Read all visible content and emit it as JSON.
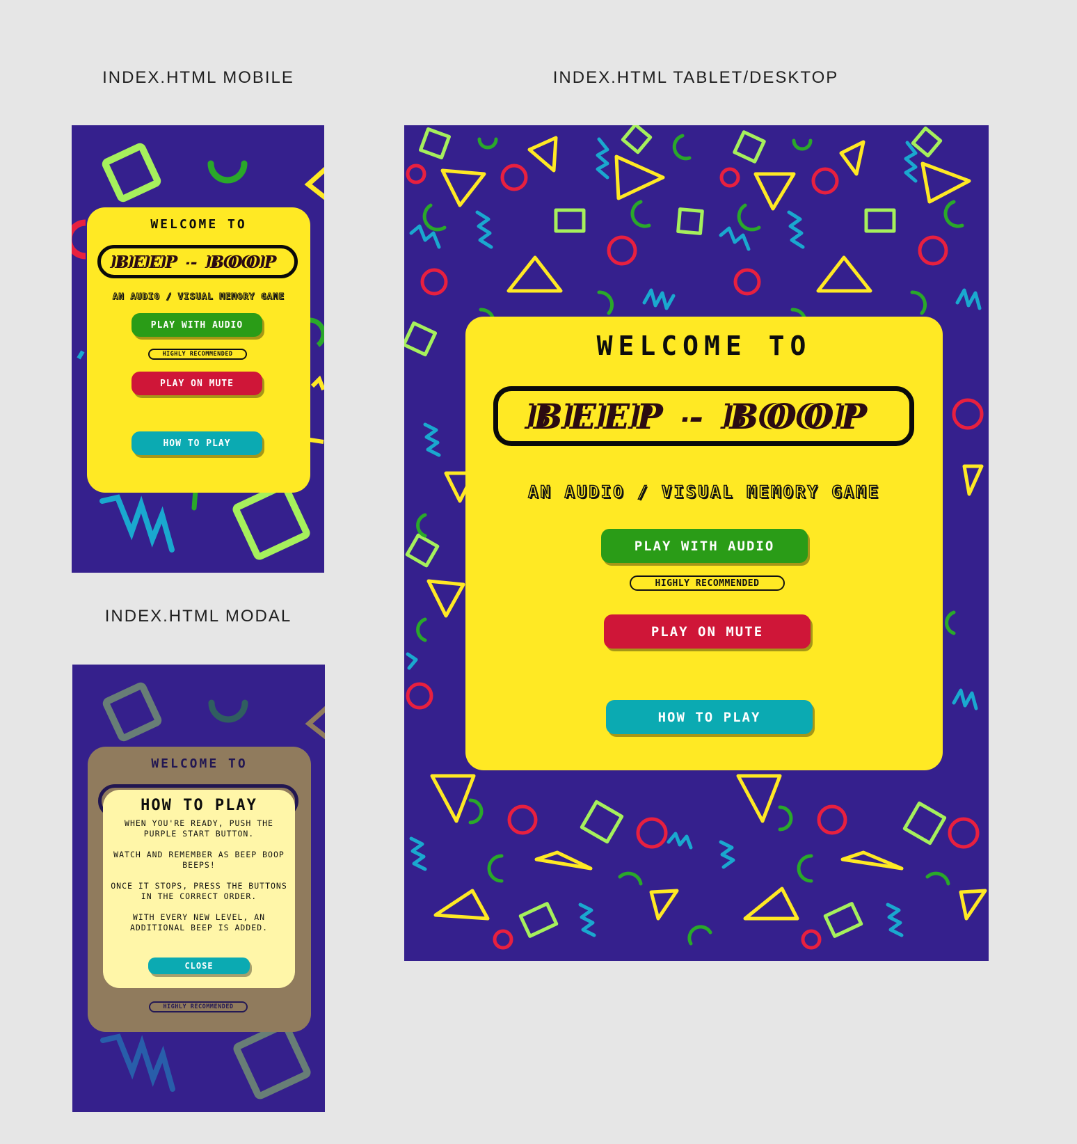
{
  "sections": {
    "mobile_title": "INDEX.HTML MOBILE",
    "tablet_title": "INDEX.HTML TABLET/DESKTOP",
    "modal_title": "INDEX.HTML MODAL"
  },
  "home": {
    "welcome": "WELCOME TO",
    "logo": "BEEP - BOOP",
    "subtitle": "AN AUDIO / VISUAL MEMORY GAME",
    "play_audio": "PLAY WITH AUDIO",
    "recommended": "HIGHLY RECOMMENDED",
    "play_mute": "PLAY ON MUTE",
    "how_to_play": "HOW TO PLAY"
  },
  "modal": {
    "title": "HOW TO PLAY",
    "paragraphs": [
      "WHEN YOU'RE READY, PUSH THE PURPLE START BUTTON.",
      "WATCH AND REMEMBER AS BEEP BOOP BEEPS!",
      "ONCE IT STOPS, PRESS THE BUTTONS IN THE CORRECT ORDER.",
      "WITH EVERY NEW LEVEL, AN ADDITIONAL BEEP IS ADDED."
    ],
    "close": "CLOSE"
  },
  "colors": {
    "background": "#35208d",
    "card": "#ffe924",
    "green": "#2a9c17",
    "red": "#cf1638",
    "teal": "#0baab2",
    "modal": "#fff6a8"
  },
  "icons": [
    "square-shape",
    "triangle-shape",
    "circle-shape",
    "arc-shape",
    "zigzag-shape"
  ]
}
